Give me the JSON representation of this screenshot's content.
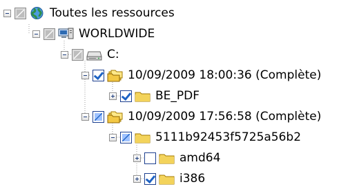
{
  "tree": {
    "root": {
      "label": "Toutes les ressources"
    },
    "computer": {
      "label": "WORLDWIDE"
    },
    "drive": {
      "label": "C:"
    },
    "backup1": {
      "label": "10/09/2009 18:00:36 (Complète)"
    },
    "backup1_child": {
      "label": "BE_PDF"
    },
    "backup2": {
      "label": "10/09/2009 17:56:58 (Complète)"
    },
    "backup2_child": {
      "label": "5111b92453f5725a56b2"
    },
    "backup2_grandchild1": {
      "label": "amd64"
    },
    "backup2_grandchild2": {
      "label": "i386"
    }
  },
  "icons": {
    "globe": "globe-icon",
    "computer": "computer-icon",
    "drive": "drive-icon",
    "backup": "backup-icon",
    "folder": "folder-icon"
  },
  "colors": {
    "tree_lines": "#9b9b9b",
    "checkbox_border": "#1c3f8f",
    "checkbox_check": "#1e63c4",
    "folder": "#f3d35b",
    "globe": "#2f8f49"
  }
}
